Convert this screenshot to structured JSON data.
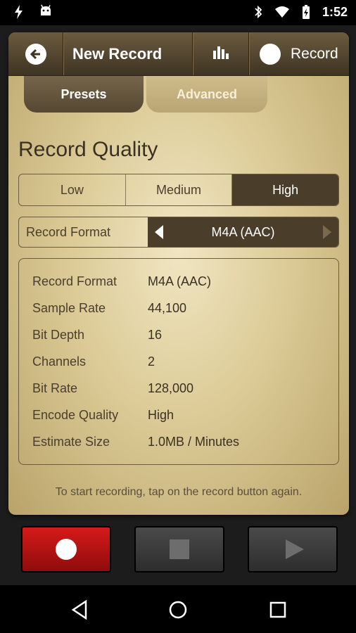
{
  "status_bar": {
    "time": "1:52",
    "left_icons": [
      "flash-icon",
      "android-icon"
    ],
    "right_icons": [
      "bluetooth-icon",
      "wifi-icon",
      "battery-icon"
    ]
  },
  "header": {
    "title": "New Record",
    "record_label": "Record"
  },
  "tabs": [
    {
      "label": "Presets",
      "active": true
    },
    {
      "label": "Advanced",
      "active": false
    }
  ],
  "section_title": "Record Quality",
  "quality": {
    "options": [
      "Low",
      "Medium",
      "High"
    ],
    "selected": "High"
  },
  "format": {
    "label": "Record Format",
    "value": "M4A (AAC)"
  },
  "details": [
    {
      "key": "Record Format",
      "value": "M4A (AAC)"
    },
    {
      "key": "Sample Rate",
      "value": "44,100"
    },
    {
      "key": "Bit Depth",
      "value": "16"
    },
    {
      "key": "Channels",
      "value": "2"
    },
    {
      "key": "Bit Rate",
      "value": "128,000"
    },
    {
      "key": "Encode Quality",
      "value": "High"
    },
    {
      "key": "Estimate Size",
      "value": "1.0MB / Minutes"
    }
  ],
  "hint": "To start recording, tap on the record button again.",
  "colors": {
    "accent_dark": "#4a3d2a",
    "record_red": "#d61a1a",
    "panel_gold": "#dccb97"
  }
}
